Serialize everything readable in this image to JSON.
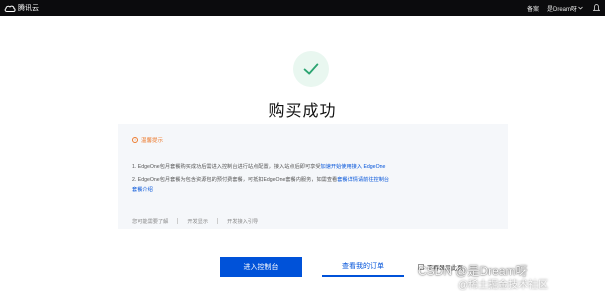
{
  "header": {
    "logo_text": "腾讯云",
    "nav_items": [
      "备案",
      "是Dream呀"
    ]
  },
  "result": {
    "title": "购买成功"
  },
  "notice": {
    "heading": "温馨提示",
    "line1_prefix": "1. EdgeOne包月套餐购买成功后需进入控制台进行站点配置，接入站点后即可享受",
    "line1_link": "加速开始使用接入 EdgeOne",
    "line2_prefix": "2. EdgeOne包月套餐为包含资源包的预付费套餐，可抵扣EdgeOne套餐内服务，如需查看",
    "line2_link": "套餐详情请前往控制台",
    "line3_link": "套餐介绍",
    "hints": [
      "您可能需要了解",
      "开发显示",
      "开发接入引导"
    ]
  },
  "actions": {
    "primary": "进入控制台",
    "secondary": "查看我的订单",
    "checkbox_label": "不再显示此页"
  },
  "watermark": {
    "line1": "CSDN @是Dream呀",
    "line2": "@稀土掘金技术社区"
  },
  "colors": {
    "primary": "#0052d9",
    "success": "#2ba471",
    "warning": "#ed7b2f",
    "topbar": "#0b0b0d"
  }
}
